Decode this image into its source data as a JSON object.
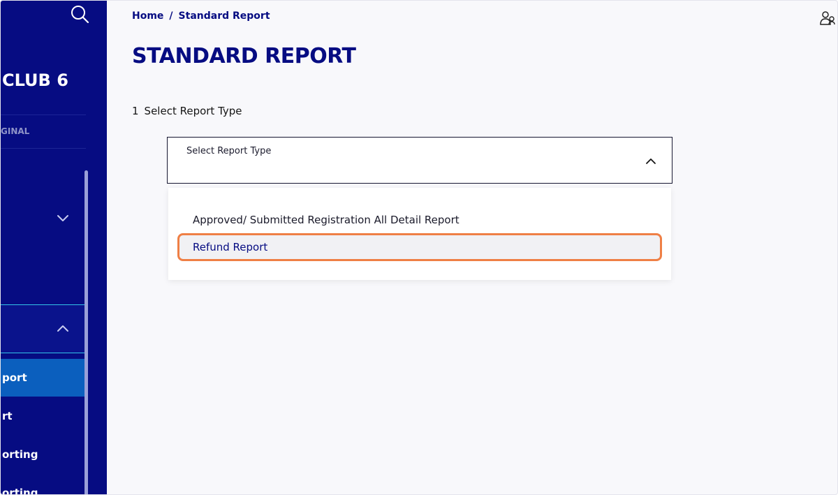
{
  "sidebar": {
    "club_name": "CLUB 6",
    "subtitle": "GINAL",
    "items": [
      {
        "label": "port",
        "active": true
      },
      {
        "label": "rt",
        "active": false
      },
      {
        "label": "orting",
        "active": false
      },
      {
        "label": "orting",
        "active": false
      }
    ]
  },
  "breadcrumb": {
    "home": "Home",
    "separator": "/",
    "current": "Standard Report"
  },
  "page": {
    "title": "STANDARD REPORT"
  },
  "step": {
    "number": "1",
    "label": "Select Report Type"
  },
  "select": {
    "label": "Select Report Type",
    "options": [
      {
        "label": "Approved/ Submitted Registration All Detail Report",
        "selected": false
      },
      {
        "label": "Refund Report",
        "selected": true
      }
    ]
  },
  "colors": {
    "sidebar_bg": "#060c82",
    "active_item": "#0b5fbe",
    "brand_text": "#060c82",
    "highlight": "#ef7f45"
  },
  "icons": {
    "search": "search-icon",
    "user": "user-group-icon",
    "chevron_up": "chevron-up-icon",
    "chevron_down": "chevron-down-icon"
  }
}
